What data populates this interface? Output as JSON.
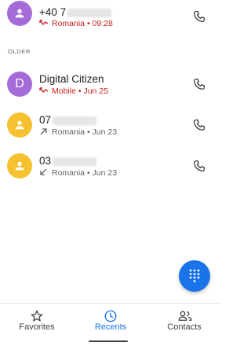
{
  "calls": [
    {
      "number": "+40 7",
      "type": "missed",
      "meta": "Romania • 09:28"
    }
  ],
  "section_label": "OLDER",
  "older_calls": [
    {
      "avatar_letter": "D",
      "name": "Digital Citizen",
      "type": "missed",
      "meta": "Mobile • Jun 25"
    },
    {
      "number": "07",
      "type": "outgoing",
      "meta": "Romania • Jun 23"
    },
    {
      "number": "03",
      "type": "incoming",
      "meta": "Romania • Jun 23"
    }
  ],
  "fab_icon": "dialpad-icon",
  "nav": {
    "items": [
      {
        "label": "Favorites",
        "icon": "star-icon"
      },
      {
        "label": "Recents",
        "icon": "clock-icon",
        "active": true
      },
      {
        "label": "Contacts",
        "icon": "people-icon"
      }
    ]
  },
  "colors": {
    "accent": "#1a73e8",
    "missed": "#c5221f",
    "avatar_purple": "#a56cd9",
    "avatar_yellow": "#f6c12f"
  }
}
